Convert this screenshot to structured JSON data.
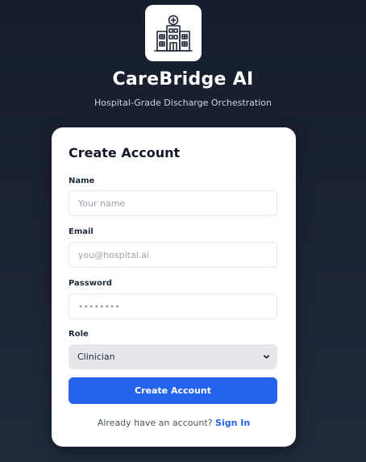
{
  "header": {
    "logo_icon": "hospital-building-icon",
    "title": "CareBridge AI",
    "subtitle": "Hospital-Grade Discharge Orchestration"
  },
  "form": {
    "title": "Create Account",
    "name": {
      "label": "Name",
      "placeholder": "Your name",
      "value": ""
    },
    "email": {
      "label": "Email",
      "placeholder": "you@hospital.ai",
      "value": ""
    },
    "password": {
      "label": "Password",
      "placeholder": "••••••••",
      "value": ""
    },
    "role": {
      "label": "Role",
      "selected": "Clinician"
    },
    "submit_label": "Create Account",
    "signin_prompt": "Already have an account?",
    "signin_link": "Sign In"
  },
  "colors": {
    "background": "#1b2435",
    "card": "#ffffff",
    "accent": "#2563eb",
    "select_bg": "#e5e7eb"
  }
}
